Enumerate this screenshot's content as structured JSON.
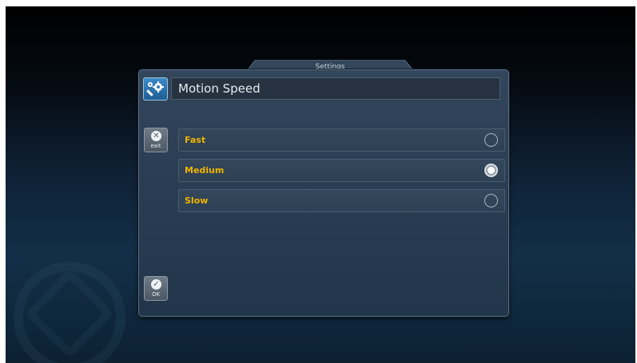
{
  "dialog": {
    "tab_title": "Settings",
    "title": "Motion Speed",
    "title_icon": "wrench-gear-icon"
  },
  "side_buttons": {
    "exit": {
      "label": "exit",
      "icon": "close-circle-icon"
    },
    "ok": {
      "label": "OK",
      "icon": "check-circle-icon"
    }
  },
  "options": [
    {
      "label": "Fast",
      "selected": false
    },
    {
      "label": "Medium",
      "selected": true
    },
    {
      "label": "Slow",
      "selected": false
    }
  ],
  "colors": {
    "option_text": "#f0b400",
    "panel": "#2a3d52",
    "accent_icon": "#2f7bbd"
  }
}
